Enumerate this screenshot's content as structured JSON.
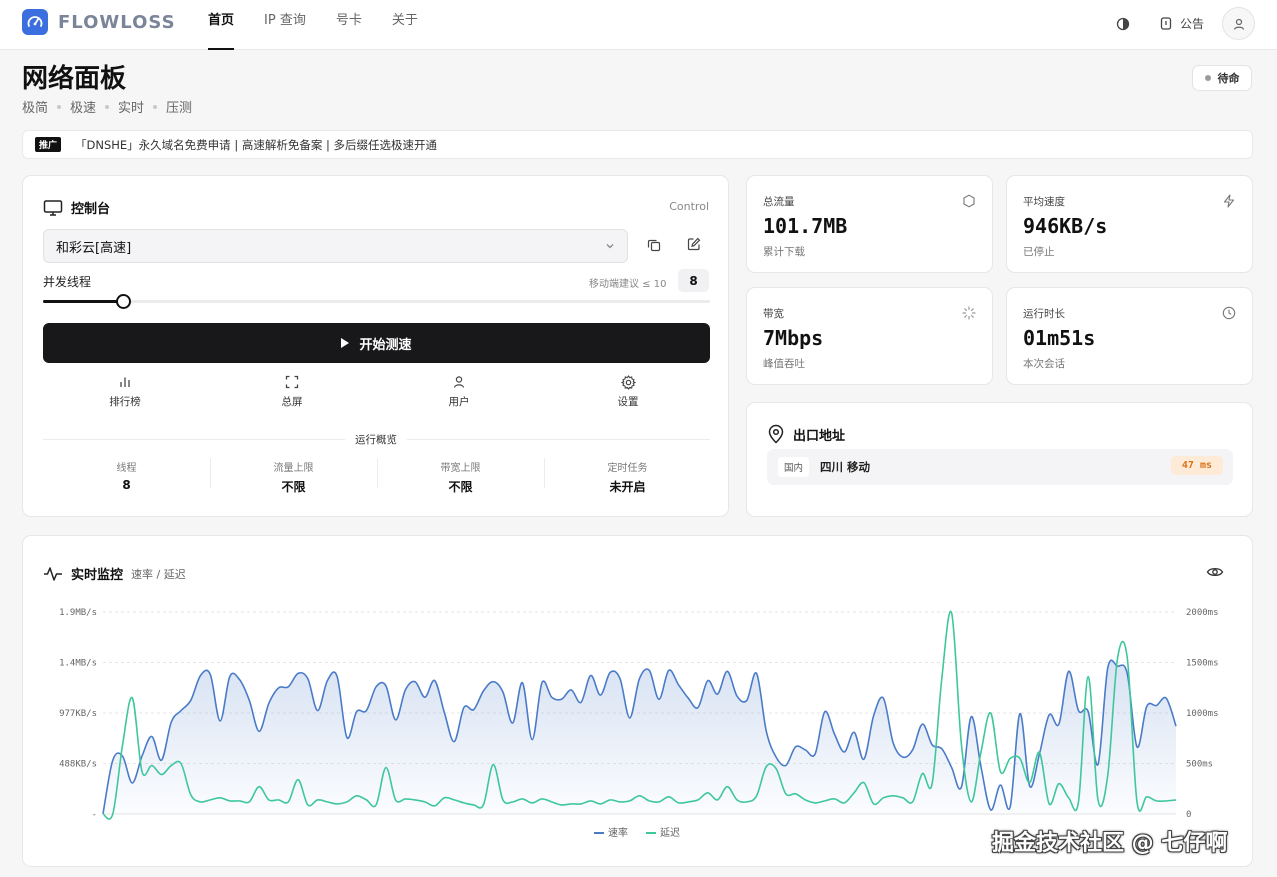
{
  "app": {
    "name": "FLOWLOSS",
    "brand_color": "#3b6fe0"
  },
  "nav": [
    {
      "label": "首页",
      "active": true
    },
    {
      "label": "IP 查询",
      "active": false
    },
    {
      "label": "号卡",
      "active": false
    },
    {
      "label": "关于",
      "active": false
    }
  ],
  "topbar": {
    "notice_label": "公告",
    "theme_icon": "contrast-icon",
    "user_icon": "user-icon"
  },
  "header": {
    "title": "网络面板",
    "tags": [
      "极简",
      "极速",
      "实时",
      "压测"
    ],
    "status": "待命"
  },
  "promo": {
    "tag": "推广",
    "text": "「DNSHE」永久域名免费申请 | 高速解析免备案 | 多后缀任选极速开通"
  },
  "control": {
    "title": "控制台",
    "title_en": "Control",
    "node": "和彩云[高速]",
    "thread_label": "并发线程",
    "thread_hint": "移动端建议 ≤ 10",
    "threads": "8",
    "slider_fraction": 0.12,
    "start_label": "开始测速",
    "quick": [
      {
        "label": "排行榜",
        "icon": "bar-chart-icon"
      },
      {
        "label": "总屏",
        "icon": "fullscreen-icon"
      },
      {
        "label": "用户",
        "icon": "user-icon"
      },
      {
        "label": "设置",
        "icon": "gear-icon"
      }
    ],
    "overview_title": "运行概览",
    "overview": [
      {
        "label": "线程",
        "value": "8"
      },
      {
        "label": "流量上限",
        "value": "不限"
      },
      {
        "label": "带宽上限",
        "value": "不限"
      },
      {
        "label": "定时任务",
        "value": "未开启"
      }
    ]
  },
  "stats": [
    {
      "label": "总流量",
      "value": "101.7MB",
      "sub": "累计下载",
      "icon": "hexagon-icon"
    },
    {
      "label": "平均速度",
      "value": "946KB/s",
      "sub": "已停止",
      "icon": "bolt-icon"
    },
    {
      "label": "带宽",
      "value": "7Mbps",
      "sub": "峰值吞吐",
      "icon": "loader-icon"
    },
    {
      "label": "运行时长",
      "value": "01m51s",
      "sub": "本次会话",
      "icon": "clock-icon"
    }
  ],
  "exit": {
    "title": "出口地址",
    "region_tag": "国内",
    "isp": "四川 移动",
    "latency": "47 ms"
  },
  "monitor": {
    "title": "实时监控",
    "subtitle": "速率 / 延迟"
  },
  "chart_data": {
    "type": "line",
    "title": "",
    "y_left_ticks": [
      "1.9MB/s",
      "1.4MB/s",
      "977KB/s",
      "488KB/s",
      "-"
    ],
    "y_right_ticks": [
      "2000ms",
      "1500ms",
      "1000ms",
      "500ms",
      "0"
    ],
    "y_left_max_kbps": 1954,
    "y_right_max_ms": 2000,
    "x_points": 111,
    "series": [
      {
        "name": "速率",
        "color": "#4a7bc8",
        "axis": "left",
        "values": [
          0,
          520,
          560,
          300,
          560,
          750,
          520,
          890,
          1000,
          1100,
          1340,
          1350,
          900,
          1330,
          1300,
          1100,
          800,
          1070,
          1220,
          1230,
          1360,
          1310,
          1000,
          1290,
          1330,
          740,
          990,
          1000,
          1230,
          1240,
          910,
          1200,
          1280,
          1130,
          1290,
          980,
          700,
          1030,
          1010,
          1190,
          1280,
          1180,
          880,
          1270,
          720,
          1270,
          1130,
          1110,
          1200,
          1080,
          1340,
          1150,
          1370,
          1310,
          930,
          1310,
          1390,
          1110,
          1390,
          1250,
          1120,
          1030,
          1290,
          1160,
          1380,
          1140,
          1100,
          1360,
          800,
          550,
          470,
          650,
          620,
          580,
          990,
          770,
          600,
          790,
          530,
          950,
          1120,
          690,
          550,
          620,
          870,
          670,
          630,
          450,
          260,
          940,
          460,
          40,
          280,
          70,
          970,
          270,
          580,
          960,
          870,
          1380,
          1000,
          990,
          480,
          1410,
          1430,
          1360,
          650,
          1040,
          1050,
          1120,
          850
        ]
      },
      {
        "name": "延迟",
        "color": "#3ec79c",
        "axis": "right",
        "values": [
          0,
          0,
          680,
          1150,
          420,
          480,
          390,
          480,
          500,
          190,
          120,
          140,
          160,
          130,
          130,
          120,
          270,
          140,
          140,
          120,
          340,
          90,
          140,
          120,
          100,
          120,
          180,
          140,
          90,
          460,
          140,
          150,
          140,
          120,
          80,
          160,
          140,
          110,
          90,
          90,
          490,
          140,
          120,
          150,
          110,
          150,
          120,
          90,
          100,
          100,
          130,
          100,
          140,
          120,
          130,
          180,
          130,
          120,
          170,
          110,
          120,
          140,
          210,
          140,
          270,
          140,
          120,
          180,
          470,
          450,
          200,
          200,
          140,
          110,
          130,
          150,
          110,
          210,
          310,
          100,
          160,
          180,
          160,
          120,
          400,
          300,
          1350,
          1990,
          690,
          120,
          610,
          1000,
          420,
          550,
          550,
          310,
          610,
          100,
          300,
          160,
          120,
          1360,
          140,
          380,
          1540,
          1550,
          120,
          170,
          130,
          130,
          140
        ]
      }
    ],
    "legend_position": "bottom-center",
    "grid": true
  },
  "watermark": "掘金技术社区 @ 七仔啊"
}
